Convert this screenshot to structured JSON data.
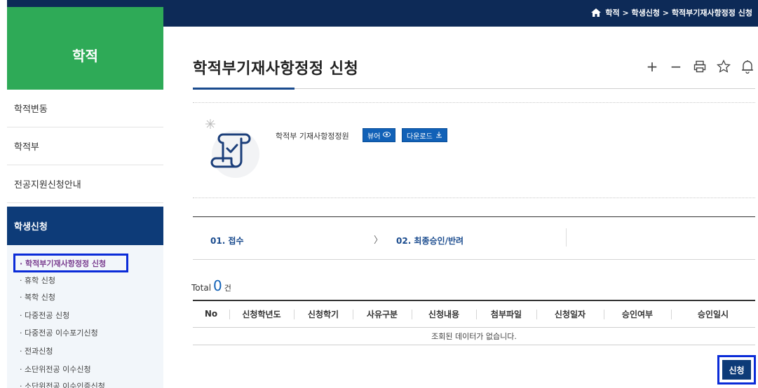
{
  "breadcrumb": {
    "text": "학적 > 학생신청 > 학적부기재사항정정 신청"
  },
  "sidebar": {
    "header": "학적",
    "items": [
      "학적변동",
      "학적부",
      "전공지원신청안내"
    ],
    "active": "학생신청",
    "subitems": [
      "· 학적부기재사항정정 신청",
      "· 휴학 신청",
      "· 복학 신청",
      "· 다중전공 신청",
      "· 다중전공 이수포기신청",
      "· 전과신청",
      "· 소단위전공 이수신청",
      "· 소단위전공 이수인증신청"
    ]
  },
  "page": {
    "title": "학적부기재사항정정 신청"
  },
  "toolbar": {
    "zoom_in": "+",
    "zoom_out": "−"
  },
  "document": {
    "name": "학적부 기재사항정정원",
    "viewer_label": "뷰어",
    "download_label": "다운로드"
  },
  "steps": {
    "step1": "01. 접수",
    "step2": "02. 최종승인/반려"
  },
  "total": {
    "label": "Total",
    "count": "0",
    "unit": "건"
  },
  "table": {
    "headers": [
      "No",
      "신청학년도",
      "신청학기",
      "사유구분",
      "신청내용",
      "첨부파일",
      "신청일자",
      "승인여부",
      "승인일시"
    ],
    "empty_message": "조회된 데이터가 없습니다."
  },
  "actions": {
    "apply_label": "신청"
  },
  "colors": {
    "topbar": "#0d2a57",
    "sidebar_header": "#2eaa57",
    "sidebar_active": "#0d3b78",
    "accent": "#1161b7",
    "highlight": "#0a2bd8"
  }
}
